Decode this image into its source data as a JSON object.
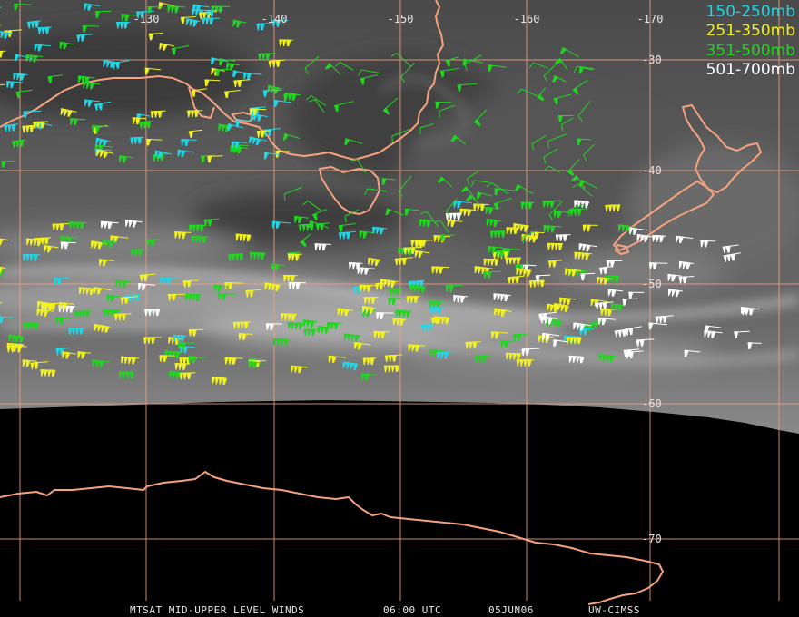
{
  "longitude_labels": [
    "-130",
    "-140",
    "-150",
    "-160",
    "-170"
  ],
  "latitude_labels": [
    "-30",
    "-40",
    "-50",
    "-60",
    "-70"
  ],
  "legend": [
    {
      "label": "150-250mb",
      "color": "#22d6e6"
    },
    {
      "label": "251-350mb",
      "color": "#f2f21e"
    },
    {
      "label": "351-500mb",
      "color": "#21d621"
    },
    {
      "label": "501-700mb",
      "color": "#ffffff"
    }
  ],
  "footer": {
    "product": "MTSAT MID-UPPER LEVEL WINDS",
    "time": "06:00 UTC",
    "date": "05JUN06",
    "credit": "UW-CIMSS"
  },
  "colors": {
    "grid": "#f0a080",
    "coast": "#f4a27f",
    "cloud_base": "#5a5a5a",
    "space": "#000000"
  }
}
